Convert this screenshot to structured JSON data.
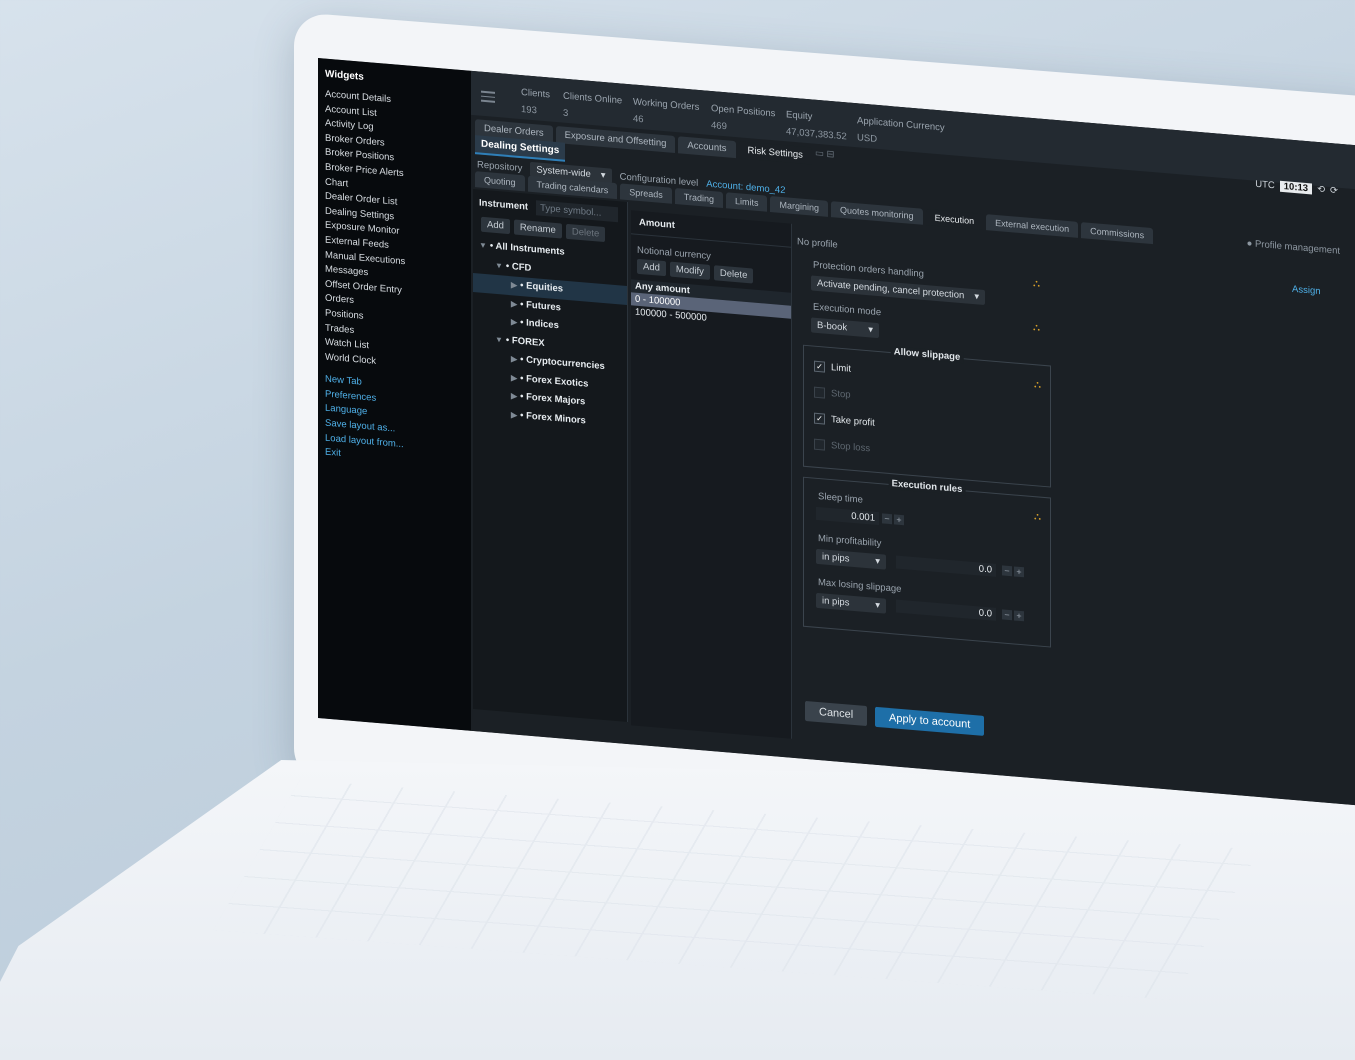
{
  "sidebar": {
    "title": "Widgets",
    "items": [
      "Account Details",
      "Account List",
      "Activity Log",
      "Broker Orders",
      "Broker Positions",
      "Broker Price Alerts",
      "Chart",
      "Dealer Order List",
      "Dealing Settings",
      "Exposure Monitor",
      "External Feeds",
      "Manual Executions",
      "Messages",
      "Offset Order Entry",
      "Orders",
      "Positions",
      "Trades",
      "Watch List",
      "World Clock"
    ],
    "links": [
      "New Tab",
      "Preferences",
      "Language",
      "Save layout as...",
      "Load layout from...",
      "Exit"
    ]
  },
  "stats": [
    {
      "label": "Clients",
      "value": "193"
    },
    {
      "label": "Clients Online",
      "value": "3"
    },
    {
      "label": "Working Orders",
      "value": "46"
    },
    {
      "label": "Open Positions",
      "value": "469"
    },
    {
      "label": "Equity",
      "value": "47,037,383.52"
    },
    {
      "label": "Application Currency",
      "value": "USD"
    }
  ],
  "clock": {
    "label": "UTC",
    "time": "10:13"
  },
  "window_tabs": [
    "Dealer Orders",
    "Exposure and Offsetting",
    "Accounts",
    "Risk Settings"
  ],
  "panel_title": "Dealing Settings",
  "repository": {
    "label": "Repository",
    "value": "System-wide",
    "config_label": "Configuration level",
    "config_value": "Account: demo_42"
  },
  "sub_tabs": [
    "Quoting",
    "Trading calendars",
    "Spreads",
    "Trading",
    "Limits",
    "Margining",
    "Quotes monitoring",
    "Execution",
    "External execution",
    "Commissions"
  ],
  "profile_management": "Profile management",
  "instrument": {
    "label": "Instrument",
    "placeholder": "Type symbol...",
    "buttons": [
      "Add",
      "Rename",
      "Delete"
    ],
    "tree": [
      {
        "label": "• All Instruments"
      },
      {
        "label": "• CFD"
      },
      {
        "label": "• Equities"
      },
      {
        "label": "• Futures"
      },
      {
        "label": "• Indices"
      },
      {
        "label": "• FOREX"
      },
      {
        "label": "• Cryptocurrencies"
      },
      {
        "label": "• Forex Exotics"
      },
      {
        "label": "• Forex Majors"
      },
      {
        "label": "• Forex Minors"
      }
    ]
  },
  "amount": {
    "title": "Amount",
    "notional": "Notional currency",
    "buttons": [
      "Add",
      "Modify",
      "Delete"
    ],
    "rows": [
      "Any amount",
      "0 - 100000",
      "100000 - 500000"
    ]
  },
  "execution": {
    "no_profile": "No profile",
    "assign": "Assign",
    "protection_label": "Protection orders handling",
    "protection_value": "Activate pending, cancel protection",
    "mode_label": "Execution mode",
    "mode_value": "B-book",
    "slippage_title": "Allow slippage",
    "slippage": [
      {
        "label": "Limit",
        "checked": true
      },
      {
        "label": "Stop",
        "checked": false
      },
      {
        "label": "Take profit",
        "checked": true
      },
      {
        "label": "Stop loss",
        "checked": false
      }
    ],
    "rules_title": "Execution rules",
    "sleep_label": "Sleep time",
    "sleep_value": "0.001",
    "minprof_label": "Min profitability",
    "minprof_unit": "in pips",
    "minprof_value": "0.0",
    "maxloss_label": "Max losing slippage",
    "maxloss_unit": "in pips",
    "maxloss_value": "0.0",
    "cancel": "Cancel",
    "apply": "Apply to account"
  },
  "colors": {
    "accent": "#2f7fb8",
    "link": "#4fb0e8",
    "apply": "#1e6fa8"
  }
}
